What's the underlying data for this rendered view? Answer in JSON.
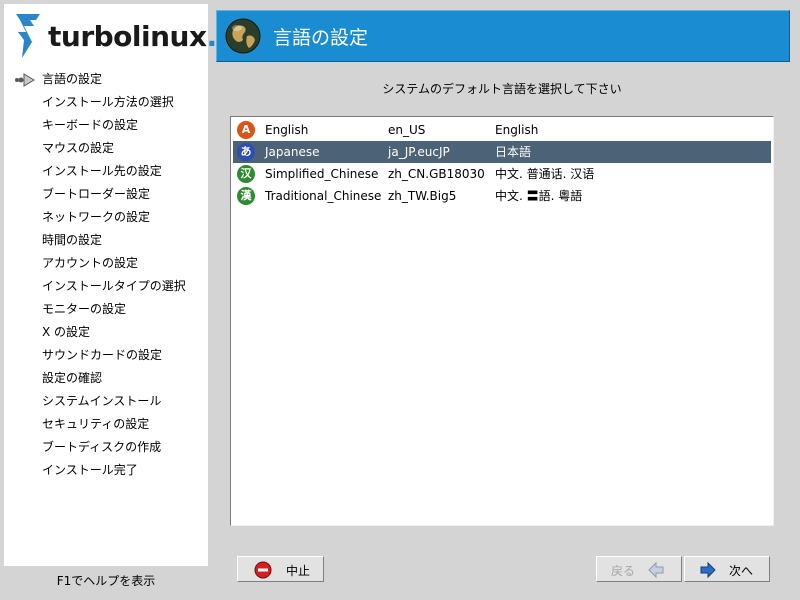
{
  "brand": {
    "name": "turbolinux",
    "dot": "."
  },
  "sidebar": {
    "current_step": 0,
    "steps": [
      "言語の設定",
      "インストール方法の選択",
      "キーボードの設定",
      "マウスの設定",
      "インストール先の設定",
      "ブートローダー設定",
      "ネットワークの設定",
      "時間の設定",
      "アカウントの設定",
      "インストールタイプの選択",
      "モニターの設定",
      "X の設定",
      "サウンドカードの設定",
      "設定の確認",
      "システムインストール",
      "セキュリティの設定",
      "ブートディスクの作成",
      "インストール完了"
    ],
    "help_text": "F1でヘルプを表示"
  },
  "header": {
    "title": "言語の設定"
  },
  "main": {
    "prompt": "システムのデフォルト言語を選択して下さい",
    "languages": [
      {
        "icon": "A",
        "name": "English",
        "code": "en_US",
        "native": "English",
        "selected": false
      },
      {
        "icon": "あ",
        "name": "Japanese",
        "code": "ja_JP.eucJP",
        "native": "日本語",
        "selected": true
      },
      {
        "icon": "汉",
        "name": "Simplified_Chinese",
        "code": "zh_CN.GB18030",
        "native": "中文. 普通话. 汉语",
        "selected": false
      },
      {
        "icon": "漢",
        "name": "Traditional_Chinese",
        "code": "zh_TW.Big5",
        "native": "中文. 〓語. 粵語",
        "selected": false
      }
    ]
  },
  "buttons": {
    "abort": "中止",
    "back": "戻る",
    "next": "次へ"
  },
  "colors": {
    "header_bg": "#1a8cd1",
    "selection_bg": "#4c6276",
    "abort_red": "#d42020",
    "arrow_blue": "#2a6fc4"
  }
}
